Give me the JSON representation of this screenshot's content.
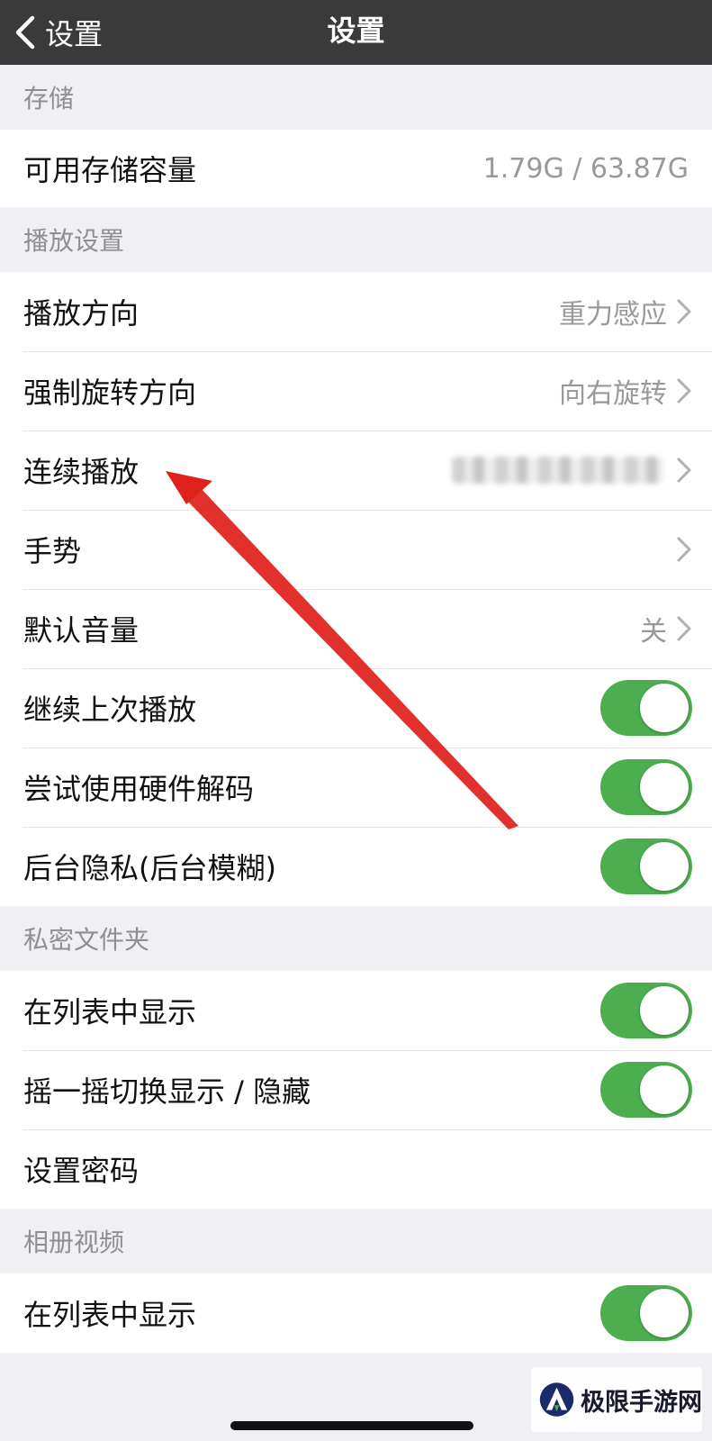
{
  "nav": {
    "back_label": "设置",
    "title": "设置"
  },
  "sections": {
    "storage": {
      "header": "存储",
      "available_label": "可用存储容量",
      "available_value": "1.79G / 63.87G"
    },
    "playback": {
      "header": "播放设置",
      "orientation_label": "播放方向",
      "orientation_value": "重力感应",
      "force_rotate_label": "强制旋转方向",
      "force_rotate_value": "向右旋转",
      "continuous_label": "连续播放",
      "gesture_label": "手势",
      "volume_label": "默认音量",
      "volume_value": "关",
      "resume_label": "继续上次播放",
      "resume_on": true,
      "hw_decode_label": "尝试使用硬件解码",
      "hw_decode_on": true,
      "bg_privacy_label": "后台隐私(后台模糊)",
      "bg_privacy_on": true
    },
    "private_folder": {
      "header": "私密文件夹",
      "show_in_list_label": "在列表中显示",
      "show_in_list_on": true,
      "shake_label": "摇一摇切换显示 / 隐藏",
      "shake_on": true,
      "password_label": "设置密码"
    },
    "album_video": {
      "header": "相册视频",
      "show_in_list_label": "在列表中显示",
      "show_in_list_on": true
    }
  },
  "watermark": {
    "text": "极限手游网"
  },
  "colors": {
    "toggle_on": "#4cae4f",
    "navbar": "#3a3a3a",
    "annotation_arrow": "#e0201b"
  },
  "icons": {
    "back": "chevron-left-icon",
    "row_chevron": "chevron-right-icon"
  }
}
